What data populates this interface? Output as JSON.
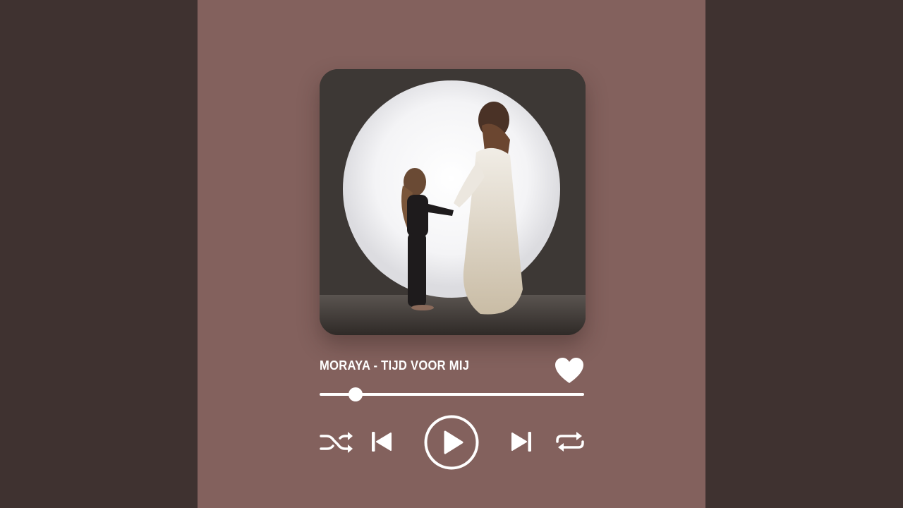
{
  "track": {
    "title": "MORAYA - TIJD VOOR MIJ",
    "progress": 0.135
  },
  "cover": {
    "description_icon": "album-cover-image"
  },
  "controls": {
    "shuffle_icon": "shuffle-icon",
    "previous_icon": "skip-previous-icon",
    "play_icon": "play-icon",
    "next_icon": "skip-next-icon",
    "repeat_icon": "repeat-icon",
    "like_icon": "heart-icon"
  },
  "colors": {
    "outer_background": "#3f3230",
    "panel_background": "#83615d",
    "foreground": "#ffffff"
  }
}
